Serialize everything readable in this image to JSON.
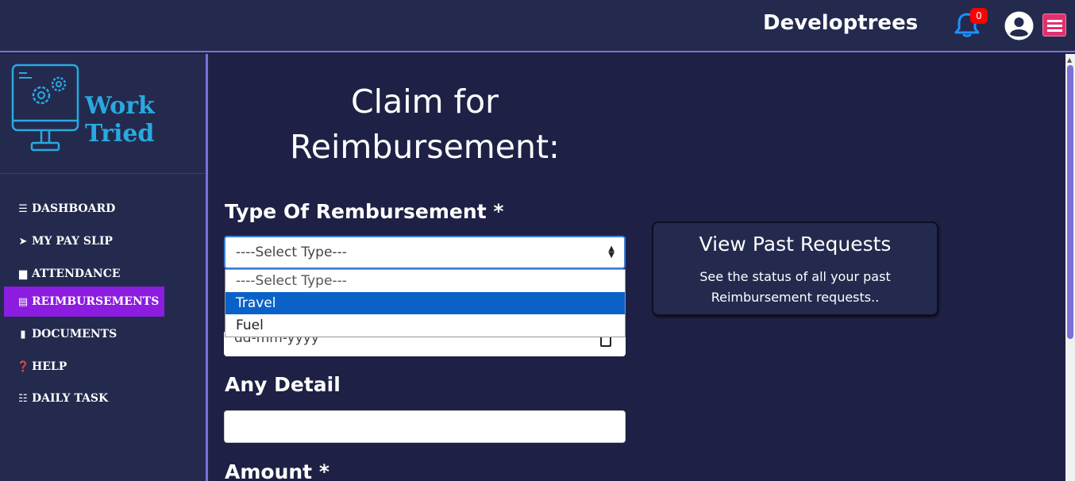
{
  "header": {
    "brand": "Developtrees",
    "notification_count": "0"
  },
  "logo": {
    "text": "Work Tried"
  },
  "sidebar": {
    "items": [
      {
        "label": "DASHBOARD",
        "icon": "list-icon"
      },
      {
        "label": "MY PAY SLIP",
        "icon": "paper-plane-icon"
      },
      {
        "label": "ATTENDANCE",
        "icon": "calendar-icon"
      },
      {
        "label": "REIMBURSEMENTS",
        "icon": "credit-card-icon",
        "active": true
      },
      {
        "label": "DOCUMENTS",
        "icon": "file-icon"
      },
      {
        "label": "HELP",
        "icon": "question-circle-icon"
      },
      {
        "label": "DAILY TASK",
        "icon": "tasks-icon"
      }
    ]
  },
  "main": {
    "title_line1": "Claim for",
    "title_line2": "Reimbursement:",
    "type_label": "Type Of Rembursement *",
    "type_select_value": "----Select Type---",
    "type_options": [
      "----Select Type---",
      "Travel",
      "Fuel"
    ],
    "highlighted_option": "Travel",
    "date_placeholder": "dd-mm-yyyy",
    "detail_label": "Any Detail",
    "detail_value": "",
    "amount_label": "Amount *"
  },
  "past_requests": {
    "title": "View Past Requests",
    "description": "See the status of all your past Reimbursement requests.."
  },
  "colors": {
    "background": "#1e2145",
    "panel": "#232a4e",
    "accent": "#7d6fd6",
    "active_nav": "#8c1de0",
    "badge": "#ff0000",
    "menu_button": "#e0306f",
    "bell": "#1e90ff",
    "highlight_option": "#0a62c8"
  }
}
